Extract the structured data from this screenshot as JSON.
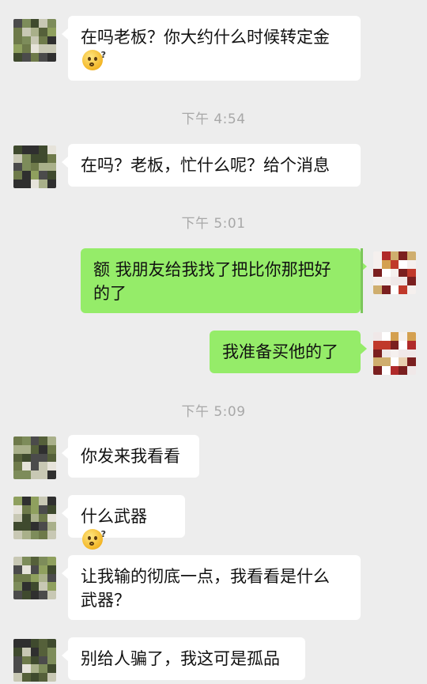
{
  "messages": [
    {
      "side": "in",
      "text": "在吗老板？你大约什么时候转定金",
      "emoji": "thinking-emoji"
    },
    {
      "side": "in",
      "text": "在吗？老板，忙什么呢？给个消息"
    },
    {
      "side": "out",
      "line1": "额 我朋友给我找了把比你那把好",
      "line2": "的了"
    },
    {
      "side": "out",
      "text": "我准备买他的了"
    },
    {
      "side": "in",
      "text": "你发来我看看"
    },
    {
      "side": "in",
      "text": "什么武器",
      "emoji": "thinking-emoji"
    },
    {
      "side": "in",
      "line1": "让我输的彻底一点，我看看是什么",
      "line2": "武器？"
    },
    {
      "side": "in",
      "text": "别给人骗了，我这可是孤品"
    }
  ],
  "timestamps": [
    "下午 4:54",
    "下午 5:01",
    "下午 5:09"
  ],
  "colors": {
    "background": "#ededed",
    "incoming_bubble": "#ffffff",
    "outgoing_bubble": "#95ec69",
    "timestamp": "#a8a8a8"
  },
  "icons": {
    "contact_avatar": "pixelated-avatar",
    "self_avatar": "pixelated-avatar",
    "emoji": "thinking-emoji"
  }
}
